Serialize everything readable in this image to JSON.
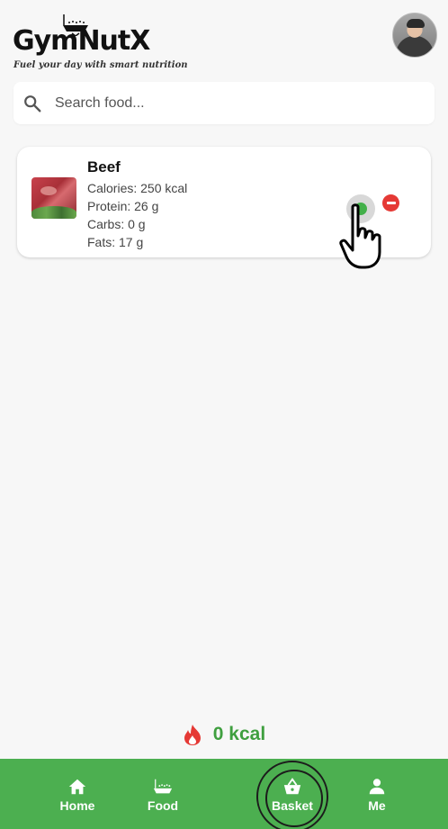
{
  "header": {
    "logo_text": "GymNutX",
    "tagline": "Fuel your day with smart nutrition"
  },
  "search": {
    "placeholder": "Search food..."
  },
  "food_card": {
    "name": "Beef",
    "calories": "Calories: 250 kcal",
    "protein": "Protein: 26 g",
    "carbs": "Carbs: 0 g",
    "fats": "Fats: 17 g"
  },
  "summary": {
    "kcal": "0 kcal"
  },
  "nav": {
    "home": "Home",
    "food": "Food",
    "basket": "Basket",
    "me": "Me"
  },
  "colors": {
    "primary_green": "#4caf50",
    "kcal_green": "#3f9f3f",
    "remove_red": "#e53935",
    "flame": "#e53935"
  },
  "icons": [
    "search-icon",
    "flame-icon",
    "home-icon",
    "bowl-icon",
    "basket-icon",
    "person-icon",
    "pointer-hand-icon"
  ]
}
